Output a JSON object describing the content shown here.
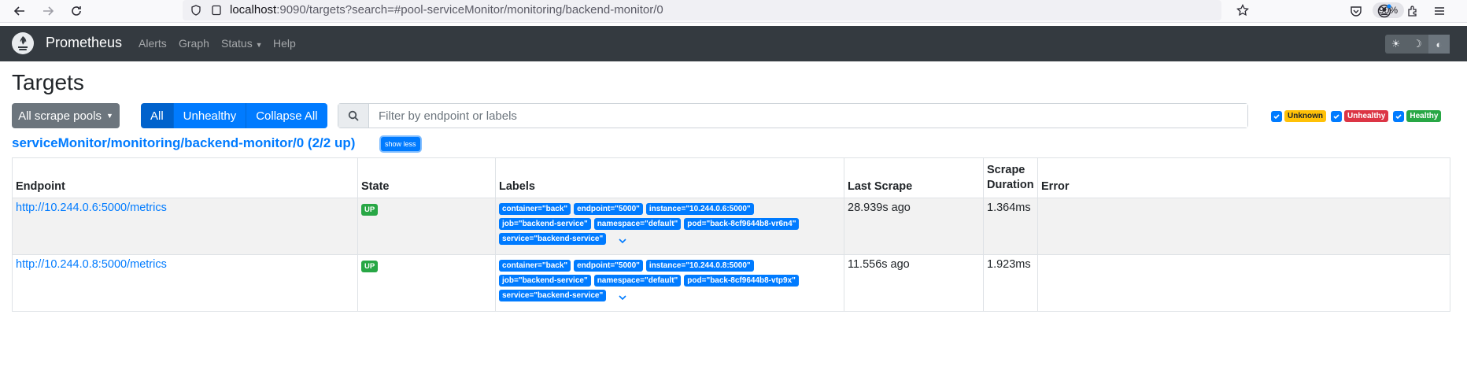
{
  "browser": {
    "url_host": "localhost",
    "url_rest": ":9090/targets?search=#pool-serviceMonitor/monitoring/backend-monitor/0",
    "zoom": "90%"
  },
  "navbar": {
    "brand": "Prometheus",
    "links": [
      "Alerts",
      "Graph",
      "Status",
      "Help"
    ]
  },
  "page": {
    "title": "Targets",
    "scrape_pools_button": "All scrape pools",
    "filter_buttons": [
      "All",
      "Unhealthy",
      "Collapse All"
    ],
    "search_placeholder": "Filter by endpoint or labels",
    "health_filters": [
      "Unknown",
      "Unhealthy",
      "Healthy"
    ]
  },
  "pool": {
    "title": "serviceMonitor/monitoring/backend-monitor/0 (2/2 up)",
    "toggle": "show less",
    "columns": [
      "Endpoint",
      "State",
      "Labels",
      "Last Scrape",
      "Scrape\nDuration",
      "Error"
    ],
    "rows": [
      {
        "endpoint": "http://10.244.0.6:5000/metrics",
        "state": "UP",
        "labels": [
          "container=\"back\"",
          "endpoint=\"5000\"",
          "instance=\"10.244.0.6:5000\"",
          "job=\"backend-service\"",
          "namespace=\"default\"",
          "pod=\"back-8cf9644b8-vr6n4\"",
          "service=\"backend-service\""
        ],
        "last_scrape": "28.939s ago",
        "duration": "1.364ms",
        "error": ""
      },
      {
        "endpoint": "http://10.244.0.8:5000/metrics",
        "state": "UP",
        "labels": [
          "container=\"back\"",
          "endpoint=\"5000\"",
          "instance=\"10.244.0.8:5000\"",
          "job=\"backend-service\"",
          "namespace=\"default\"",
          "pod=\"back-8cf9644b8-vtp9x\"",
          "service=\"backend-service\""
        ],
        "last_scrape": "11.556s ago",
        "duration": "1.923ms",
        "error": ""
      }
    ]
  },
  "colors": {
    "primary": "#007bff",
    "navbar": "#343a40",
    "up": "#28a745",
    "unknown": "#ffc107",
    "unhealthy": "#dc3545"
  }
}
